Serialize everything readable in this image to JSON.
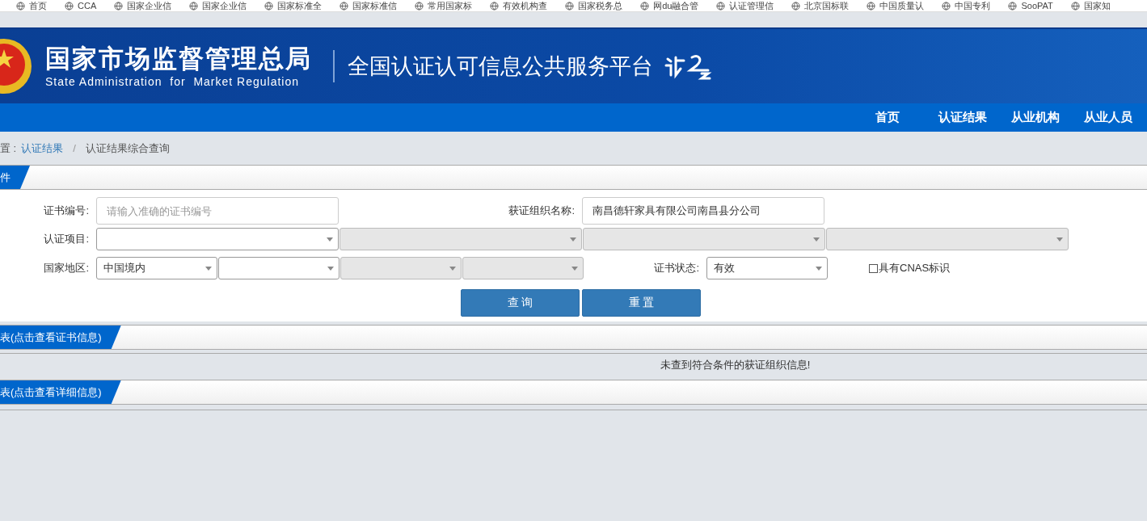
{
  "bookmarks": [
    {
      "label": "首页"
    },
    {
      "label": "CCA"
    },
    {
      "label": "国家企业信"
    },
    {
      "label": "国家企业信"
    },
    {
      "label": "国家标准全"
    },
    {
      "label": "国家标准信"
    },
    {
      "label": "常用国家标"
    },
    {
      "label": "有效机构查"
    },
    {
      "label": "国家税务总"
    },
    {
      "label": "网du融合管"
    },
    {
      "label": "认证管理信"
    },
    {
      "label": "北京国标联"
    },
    {
      "label": "中国质量认"
    },
    {
      "label": "中国专利"
    },
    {
      "label": "SooPAT"
    },
    {
      "label": "国家知"
    }
  ],
  "header": {
    "title_cn": "国家市场监督管理总局",
    "title_en": "State Administration  for  Market Regulation",
    "platform": "全国认证认可信息公共服务平台"
  },
  "nav": [
    {
      "label": "首页"
    },
    {
      "label": "认证结果"
    },
    {
      "label": "从业机构"
    },
    {
      "label": "从业人员"
    }
  ],
  "breadcrumb": {
    "prefix": "置 :",
    "link": "认证结果",
    "separator": "/",
    "current": "认证结果综合查询"
  },
  "search": {
    "tab": "件",
    "cert_no": {
      "label": "证书编号:",
      "placeholder": "请输入准确的证书编号"
    },
    "org_name": {
      "label": "获证组织名称:",
      "value": "南昌德轩家具有限公司南昌县分公司"
    },
    "project": {
      "label": "认证项目:",
      "selects": [
        {
          "disabled": false
        },
        {
          "disabled": true
        },
        {
          "disabled": true
        },
        {
          "disabled": true
        }
      ]
    },
    "region": {
      "label": "国家地区:",
      "selects": [
        {
          "value": "中国境内",
          "disabled": false
        },
        {
          "disabled": false
        },
        {
          "disabled": true
        },
        {
          "disabled": true
        }
      ]
    },
    "status": {
      "label": "证书状态:",
      "value": "有效"
    },
    "cnas": {
      "label": "具有CNAS标识",
      "checked": false
    },
    "buttons": [
      "查 询",
      "重 置"
    ]
  },
  "results": [
    {
      "tab": "表(点击查看证书信息)",
      "message": "未查到符合条件的获证组织信息!"
    },
    {
      "tab": "表(点击查看详细信息)"
    }
  ]
}
